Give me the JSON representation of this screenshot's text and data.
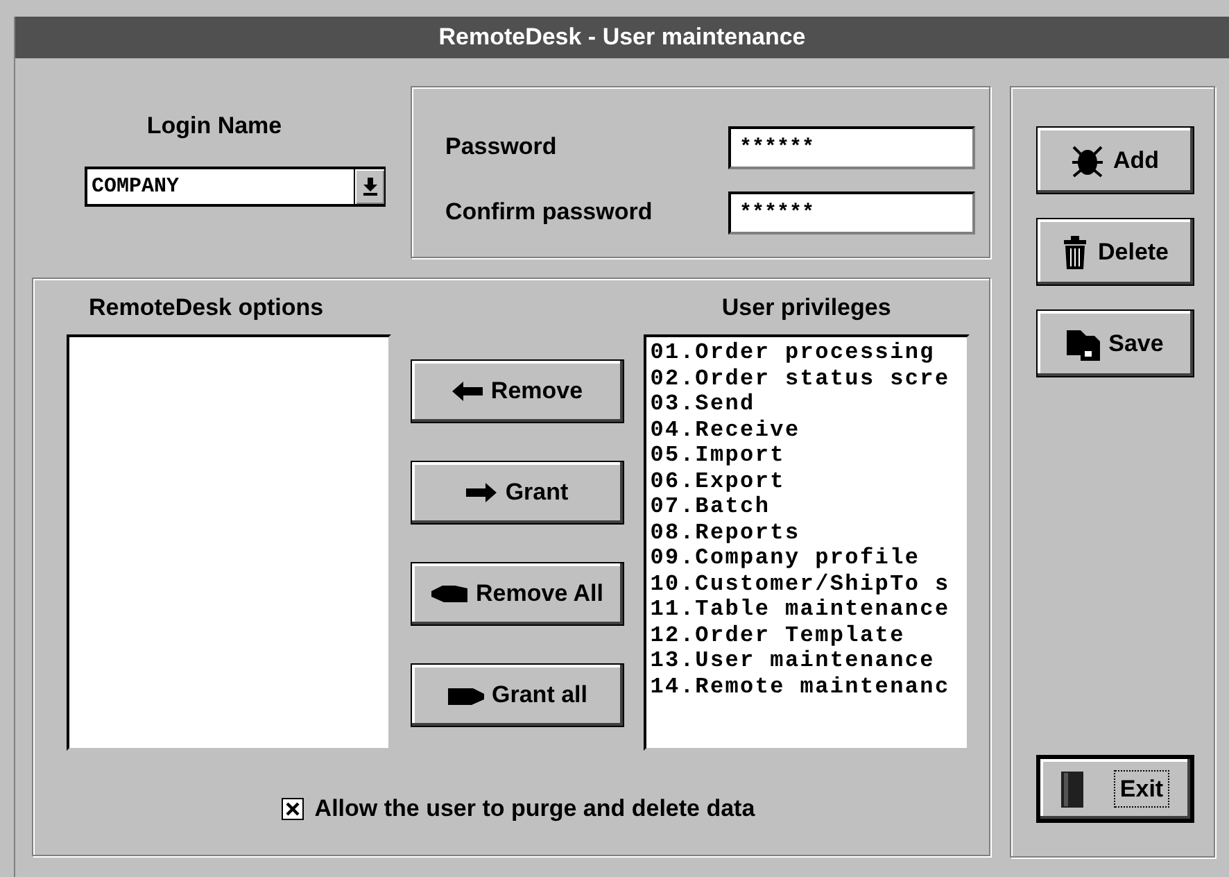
{
  "window": {
    "title": "RemoteDesk - User maintenance"
  },
  "login": {
    "label": "Login Name",
    "value": "COMPANY"
  },
  "password_fields": [
    {
      "label": "Password",
      "value": "******"
    },
    {
      "label": "Confirm password",
      "value": "******"
    }
  ],
  "options_label": "RemoteDesk options",
  "transfer_buttons": [
    {
      "label": "Remove",
      "kind": "remove"
    },
    {
      "label": "Grant",
      "kind": "grant"
    },
    {
      "label": "Remove All",
      "kind": "remove_all"
    },
    {
      "label": "Grant all",
      "kind": "grant_all"
    }
  ],
  "privileges": {
    "label": "User privileges",
    "items": [
      "01.Order processing",
      "02.Order status scre",
      "03.Send",
      "04.Receive",
      "05.Import",
      "06.Export",
      "07.Batch",
      "08.Reports",
      "09.Company profile",
      "10.Customer/ShipTo s",
      "11.Table maintenance",
      "12.Order Template",
      "13.User maintenance",
      "14.Remote maintenanc"
    ]
  },
  "purge_checkbox": {
    "label": "Allow the user to purge and delete data",
    "checked": true
  },
  "action_buttons": [
    {
      "label": "Add",
      "kind": "add"
    },
    {
      "label": "Delete",
      "kind": "delete"
    },
    {
      "label": "Save",
      "kind": "save"
    }
  ],
  "exit_button": {
    "label": "Exit",
    "focused": true
  }
}
